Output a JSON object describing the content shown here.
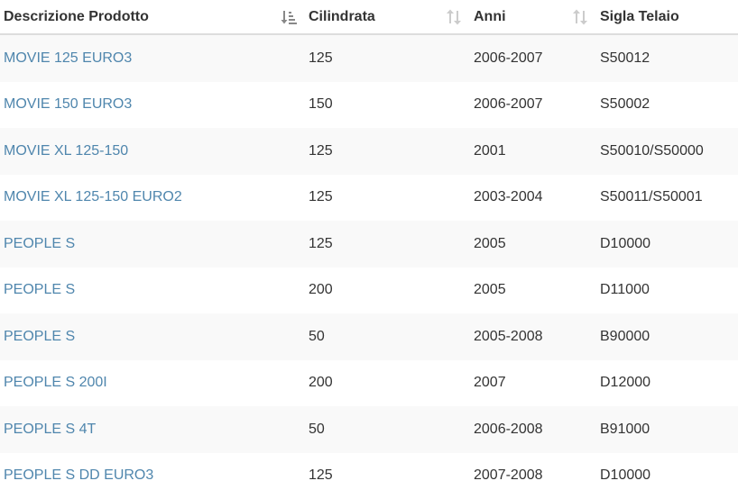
{
  "table": {
    "headers": [
      {
        "label": "Descrizione Prodotto",
        "sort_state": "active",
        "sort_icon": "sort-amount-down-icon"
      },
      {
        "label": "Cilindrata",
        "sort_state": "inactive",
        "sort_icon": "sort-arrows-icon"
      },
      {
        "label": "Anni",
        "sort_state": "inactive",
        "sort_icon": "sort-arrows-icon"
      },
      {
        "label": "Sigla Telaio",
        "sort_state": "none",
        "sort_icon": ""
      }
    ],
    "rows": [
      {
        "descrizione": "MOVIE 125 EURO3",
        "cilindrata": "125",
        "anni": "2006-2007",
        "sigla": "S50012"
      },
      {
        "descrizione": "MOVIE 150 EURO3",
        "cilindrata": "150",
        "anni": "2006-2007",
        "sigla": "S50002"
      },
      {
        "descrizione": "MOVIE XL 125-150",
        "cilindrata": "125",
        "anni": "2001",
        "sigla": "S50010/S50000"
      },
      {
        "descrizione": "MOVIE XL 125-150 EURO2",
        "cilindrata": "125",
        "anni": "2003-2004",
        "sigla": "S50011/S50001"
      },
      {
        "descrizione": "PEOPLE S",
        "cilindrata": "125",
        "anni": "2005",
        "sigla": "D10000"
      },
      {
        "descrizione": "PEOPLE S",
        "cilindrata": "200",
        "anni": "2005",
        "sigla": "D11000"
      },
      {
        "descrizione": "PEOPLE S",
        "cilindrata": "50",
        "anni": "2005-2008",
        "sigla": "B90000"
      },
      {
        "descrizione": "PEOPLE S 200I",
        "cilindrata": "200",
        "anni": "2007",
        "sigla": "D12000"
      },
      {
        "descrizione": "PEOPLE S 4T",
        "cilindrata": "50",
        "anni": "2006-2008",
        "sigla": "B91000"
      },
      {
        "descrizione": "PEOPLE S DD EURO3",
        "cilindrata": "125",
        "anni": "2007-2008",
        "sigla": "D10000"
      }
    ]
  },
  "colors": {
    "link": "#4f86ad",
    "text": "#333333",
    "stripe": "#f9f9f9",
    "header_border": "#dddddd",
    "icon_active": "#888888",
    "icon_inactive": "#cccccc"
  }
}
